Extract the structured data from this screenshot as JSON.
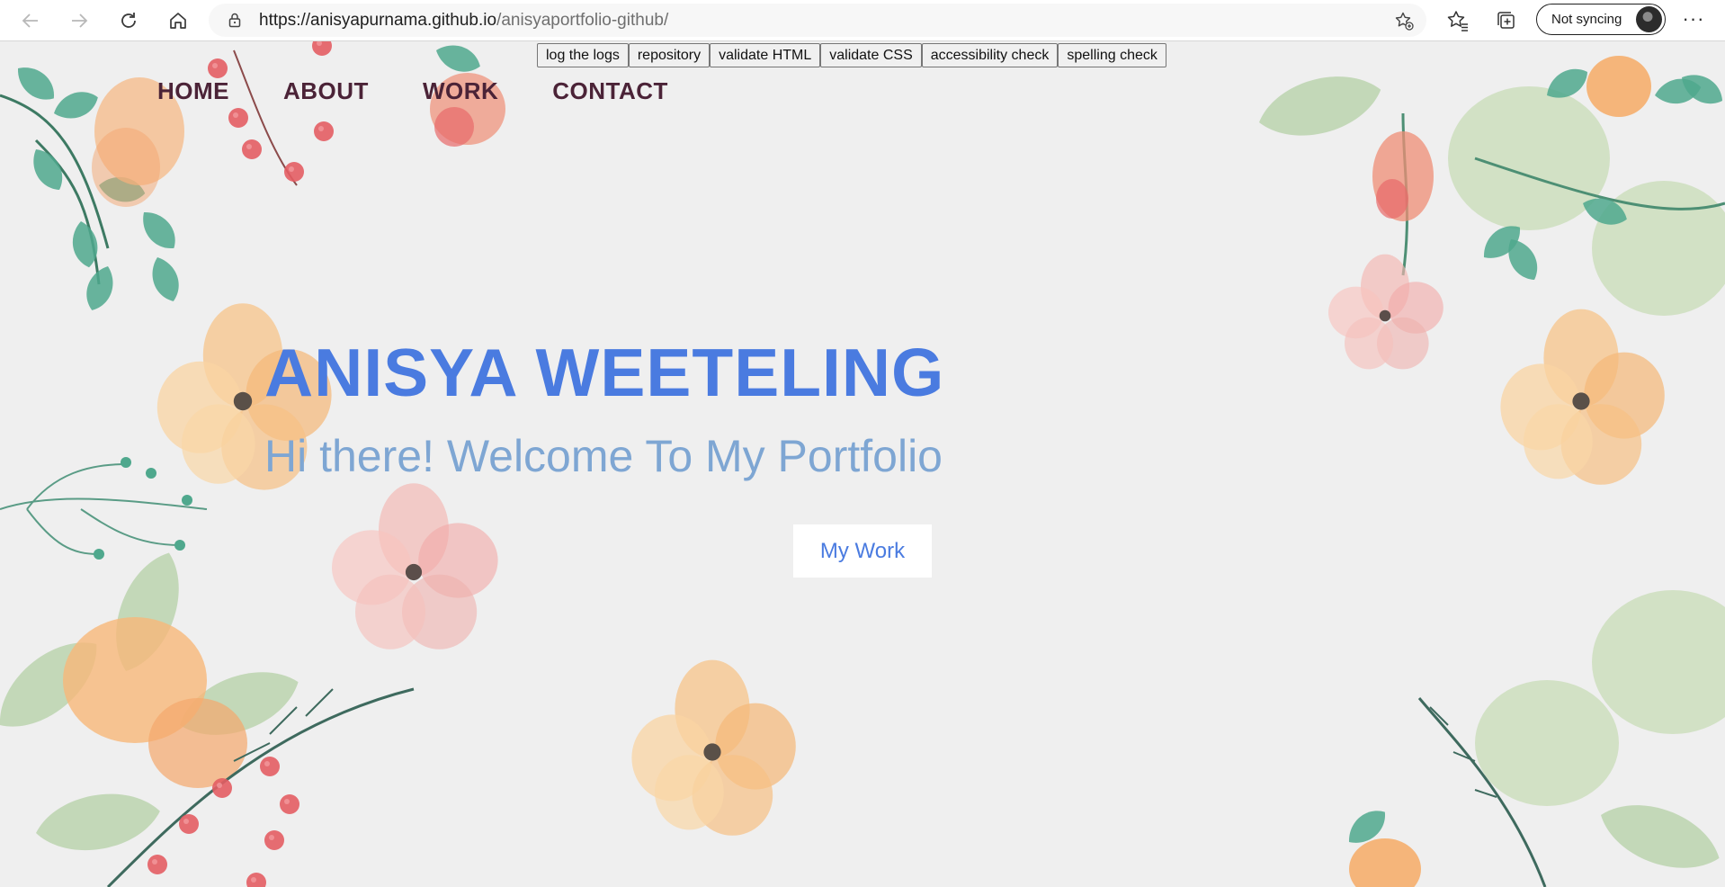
{
  "browser": {
    "back_icon": "arrow-left-icon",
    "forward_icon": "arrow-right-icon",
    "refresh_icon": "refresh-icon",
    "home_icon": "home-icon",
    "url_host": "https://anisyapurnama.github.io",
    "url_path": "/anisyaportfolio-github/",
    "sync_label": "Not syncing",
    "more_label": "···"
  },
  "devbar": {
    "buttons": [
      "log the logs",
      "repository",
      "validate HTML",
      "validate CSS",
      "accessibility check",
      "spelling check"
    ]
  },
  "nav": {
    "items": [
      "HOME",
      "ABOUT",
      "WORK",
      "CONTACT"
    ]
  },
  "hero": {
    "name": "ANISYA WEETELING",
    "tagline": "Hi there! Welcome To My Portfolio",
    "cta_label": "My Work"
  },
  "colors": {
    "accent": "#4a7be0",
    "tagline": "#7ea6d3",
    "nav_text": "#4b2337",
    "page_bg": "#efefef"
  }
}
